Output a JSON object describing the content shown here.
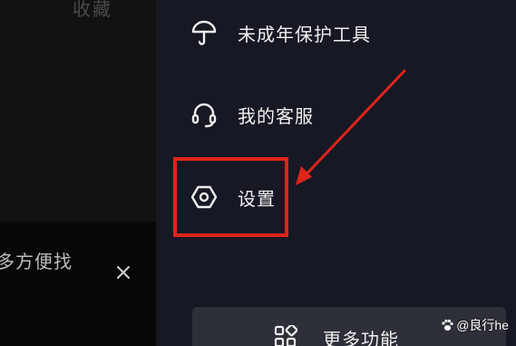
{
  "left": {
    "top_label": "收藏",
    "toast_text": "多方便找"
  },
  "menu": {
    "items": [
      {
        "icon": "umbrella-icon",
        "label": "未成年保护工具"
      },
      {
        "icon": "headset-icon",
        "label": "我的客服"
      },
      {
        "icon": "hexagon-settings-icon",
        "label": "设置"
      }
    ]
  },
  "more": {
    "icon": "grid-icon",
    "label": "更多功能"
  },
  "watermark": {
    "text": "@良行he"
  },
  "colors": {
    "background": "#161823",
    "highlight": "#e0241b",
    "text": "#f0f0f0"
  }
}
